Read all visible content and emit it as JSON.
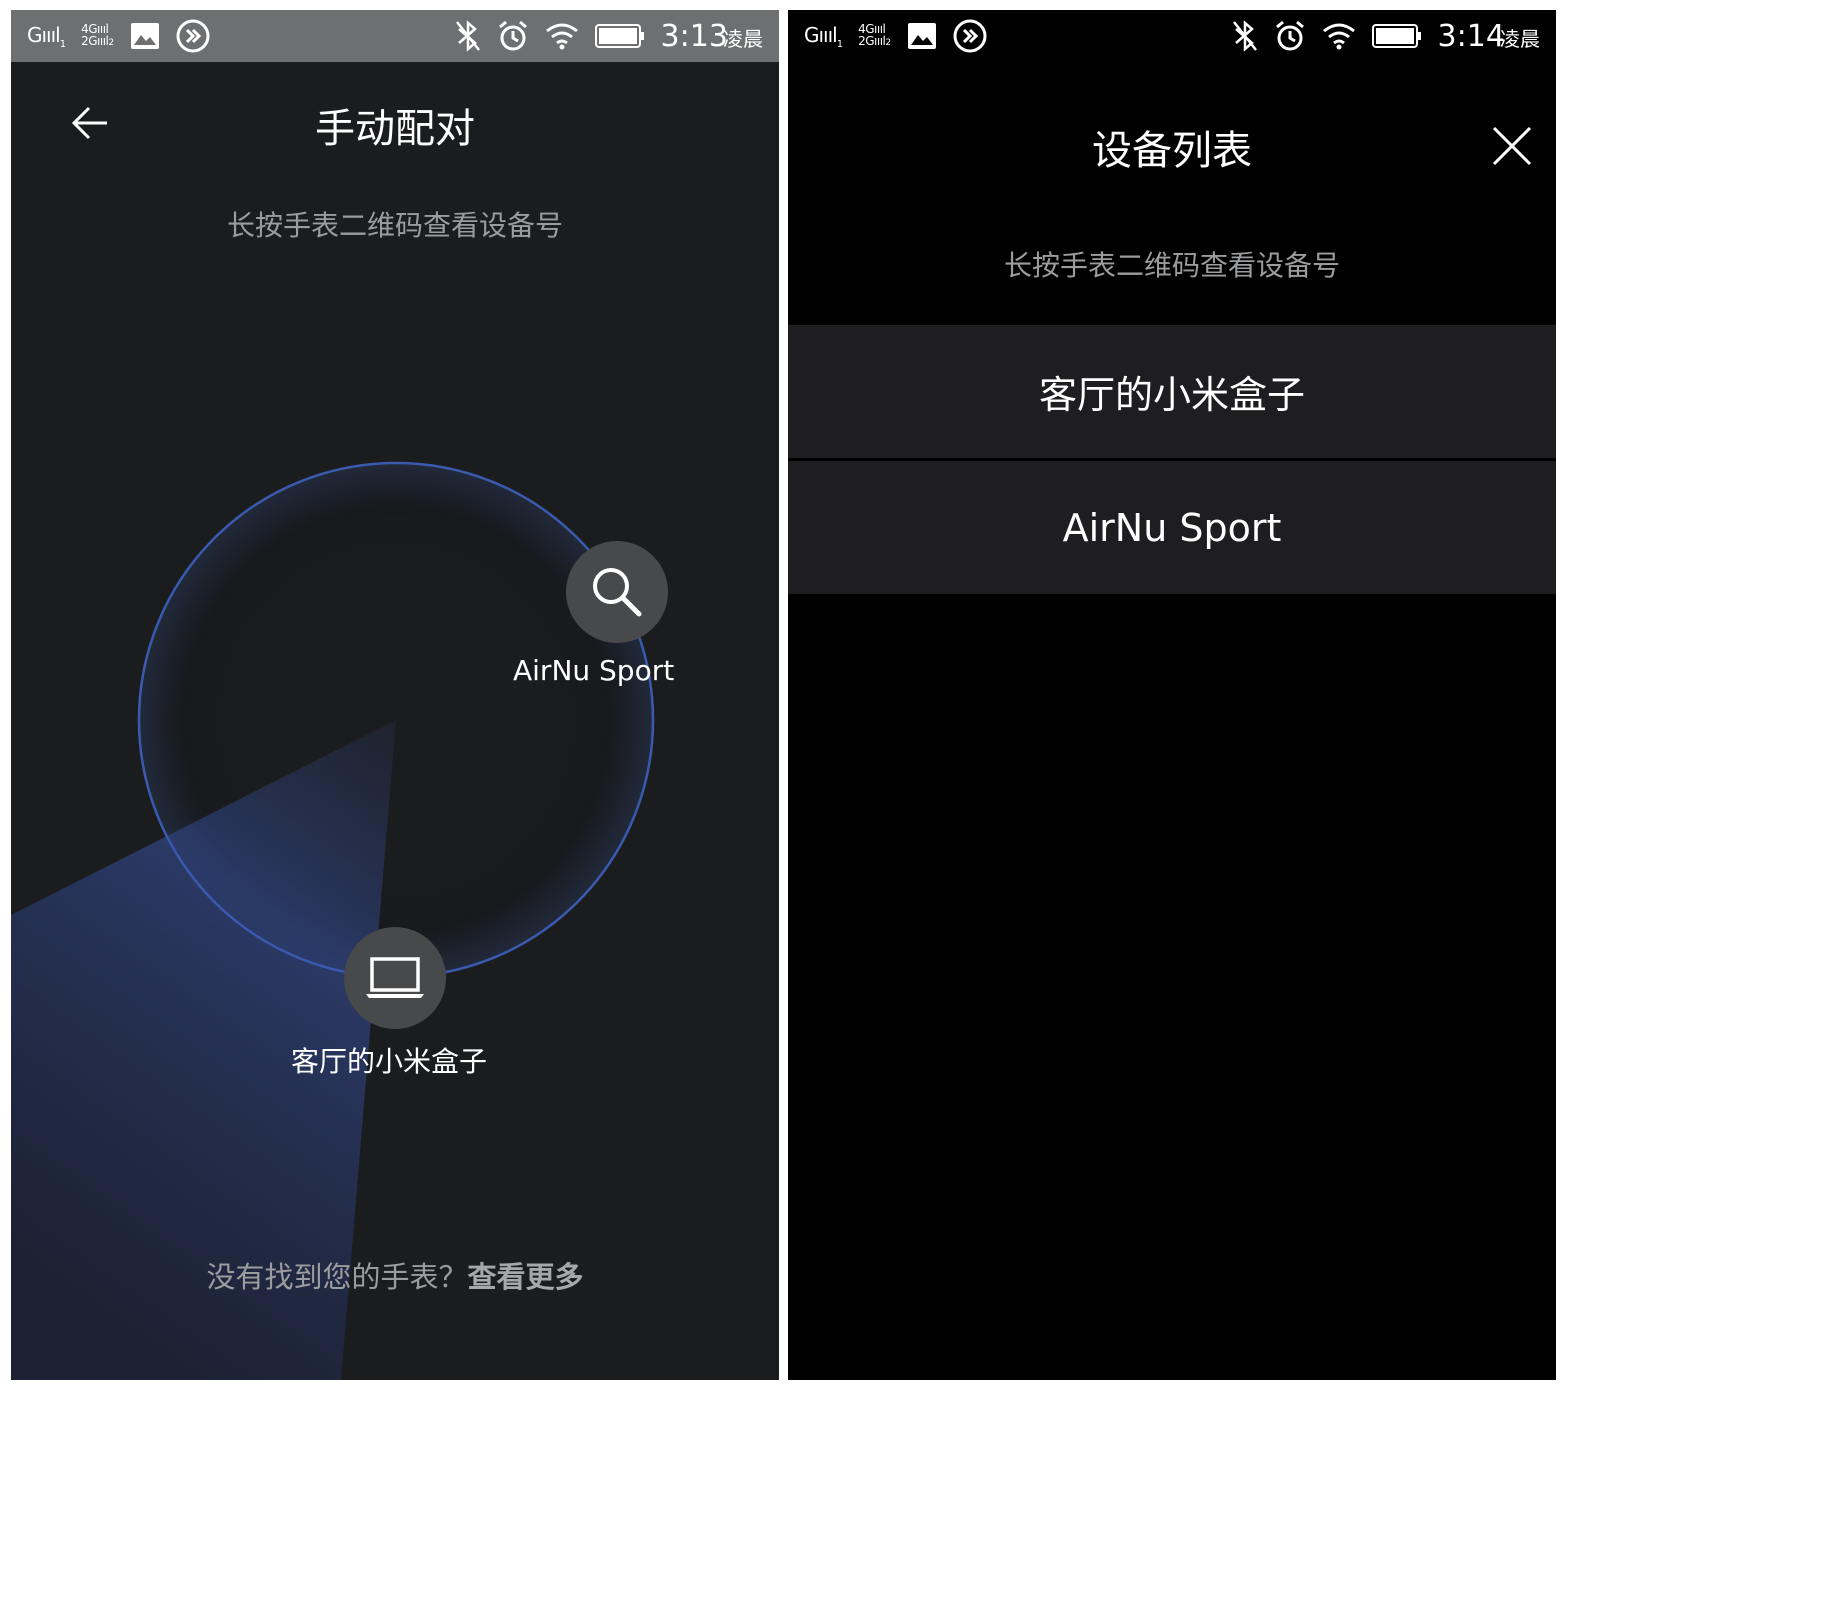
{
  "left_screen": {
    "status_bar": {
      "signal1": "Gıııl",
      "signal1_sub": "1",
      "signal2_top": "4Gıııl",
      "signal2_bottom": "2Gıııl",
      "signal2_sub": "2",
      "time": "3:13",
      "ampm": "凌晨",
      "icons": [
        "image-icon",
        "fast-forward-icon",
        "bluetooth-icon",
        "alarm-icon",
        "wifi-icon",
        "battery-icon"
      ]
    },
    "title": "手动配对",
    "subtitle": "长按手表二维码查看设备号",
    "devices": [
      {
        "label": "AirNu Sport",
        "icon": "search-icon"
      },
      {
        "label": "客厅的小米盒子",
        "icon": "laptop-icon"
      }
    ],
    "footer": {
      "text": "没有找到您的手表？",
      "link": "查看更多"
    },
    "colors": {
      "background": "#1b1c1e",
      "radar_ring": "#3a5ab0",
      "device_button": "#48494b"
    }
  },
  "right_screen": {
    "status_bar": {
      "signal1": "Gıııl",
      "signal1_sub": "1",
      "signal2_top": "4Gıııl",
      "signal2_bottom": "2Gıııl",
      "signal2_sub": "2",
      "time": "3:14",
      "ampm": "凌晨",
      "icons": [
        "image-icon",
        "fast-forward-icon",
        "bluetooth-icon",
        "alarm-icon",
        "wifi-icon",
        "battery-icon"
      ]
    },
    "title": "设备列表",
    "subtitle": "长按手表二维码查看设备号",
    "devices": [
      "客厅的小米盒子",
      "AirNu Sport"
    ],
    "colors": {
      "background": "#000000",
      "list_item": "#1e1e20"
    }
  }
}
